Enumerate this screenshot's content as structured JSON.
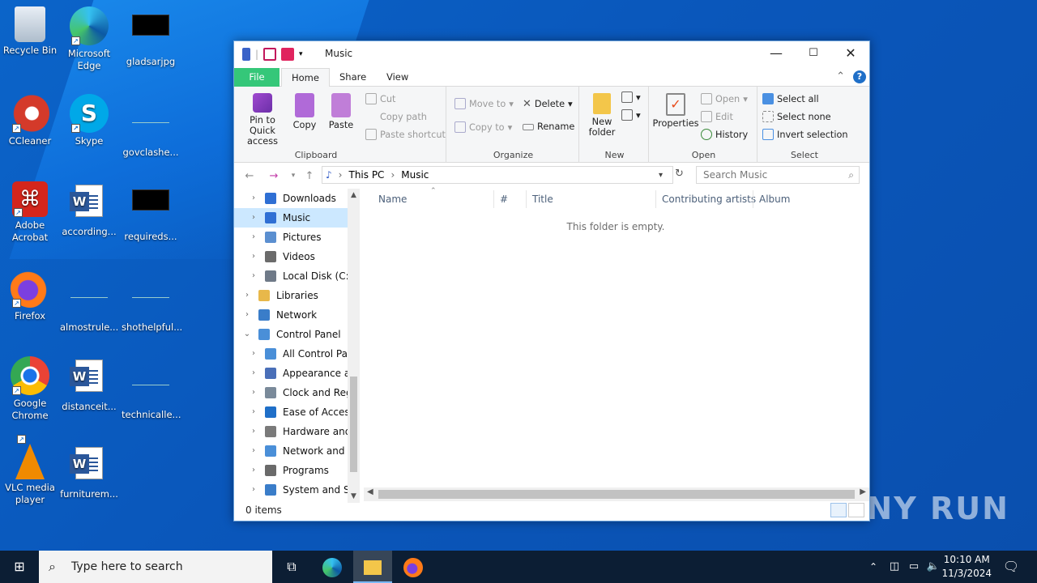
{
  "desktop": {
    "icons": [
      {
        "label": "Recycle Bin"
      },
      {
        "label": "Microsoft Edge"
      },
      {
        "label": "gladsarjpg"
      },
      {
        "label": "CCleaner"
      },
      {
        "label": "Skype"
      },
      {
        "label": "govclashe..."
      },
      {
        "label": "Adobe Acrobat"
      },
      {
        "label": "according..."
      },
      {
        "label": "requireds..."
      },
      {
        "label": "Firefox"
      },
      {
        "label": "almostrule..."
      },
      {
        "label": "shothelpful..."
      },
      {
        "label": "Google Chrome"
      },
      {
        "label": "distanceit..."
      },
      {
        "label": "technicalle..."
      },
      {
        "label": "VLC media player"
      },
      {
        "label": "furniturem..."
      }
    ]
  },
  "window": {
    "title": "Music",
    "controls": {
      "minimize": "—",
      "maximize": "☐",
      "close": "✕"
    },
    "tabs": [
      "File",
      "Home",
      "Share",
      "View"
    ],
    "ribbon": {
      "clipboard": {
        "label": "Clipboard",
        "pin": "Pin to Quick access",
        "copy": "Copy",
        "paste": "Paste",
        "cut": "Cut",
        "copy_path": "Copy path",
        "paste_shortcut": "Paste shortcut"
      },
      "organize": {
        "label": "Organize",
        "move_to": "Move to",
        "copy_to": "Copy to",
        "delete": "Delete",
        "rename": "Rename"
      },
      "new": {
        "label": "New",
        "new_folder": "New folder"
      },
      "open": {
        "label": "Open",
        "properties": "Properties",
        "open": "Open",
        "edit": "Edit",
        "history": "History"
      },
      "select": {
        "label": "Select",
        "select_all": "Select all",
        "select_none": "Select none",
        "invert": "Invert selection"
      }
    },
    "address": {
      "path": [
        "This PC",
        "Music"
      ],
      "search_placeholder": "Search Music"
    },
    "tree": [
      {
        "label": "Downloads",
        "indent": 1,
        "color": "#2f6fd4",
        "chevron": ">"
      },
      {
        "label": "Music",
        "indent": 1,
        "color": "#2f6fd4",
        "chevron": ">",
        "selected": true
      },
      {
        "label": "Pictures",
        "indent": 1,
        "color": "#5b8fd0",
        "chevron": ">"
      },
      {
        "label": "Videos",
        "indent": 1,
        "color": "#6b6b6b",
        "chevron": ">"
      },
      {
        "label": "Local Disk (C:)",
        "indent": 1,
        "color": "#6f7a88",
        "chevron": ">"
      },
      {
        "label": "Libraries",
        "indent": 0,
        "color": "#e8b84a",
        "chevron": ">"
      },
      {
        "label": "Network",
        "indent": 0,
        "color": "#3a7dc9",
        "chevron": ">"
      },
      {
        "label": "Control Panel",
        "indent": 0,
        "color": "#4a8fd8",
        "chevron": "v"
      },
      {
        "label": "All Control Par",
        "indent": 1,
        "color": "#4a8fd8",
        "chevron": ">"
      },
      {
        "label": "Appearance an",
        "indent": 1,
        "color": "#4a6fb8",
        "chevron": ">"
      },
      {
        "label": "Clock and Regi",
        "indent": 1,
        "color": "#7a8a9a",
        "chevron": ">"
      },
      {
        "label": "Ease of Access",
        "indent": 1,
        "color": "#1f6fc8",
        "chevron": ">"
      },
      {
        "label": "Hardware and",
        "indent": 1,
        "color": "#7a7a7a",
        "chevron": ">"
      },
      {
        "label": "Network and Ir",
        "indent": 1,
        "color": "#4a8fd8",
        "chevron": ">"
      },
      {
        "label": "Programs",
        "indent": 1,
        "color": "#6a6a6a",
        "chevron": ">"
      },
      {
        "label": "System and Se",
        "indent": 1,
        "color": "#3a7dc9",
        "chevron": ">"
      }
    ],
    "columns": [
      "Name",
      "#",
      "Title",
      "Contributing artists",
      "Album"
    ],
    "empty_message": "This folder is empty.",
    "status": "0 items"
  },
  "taskbar": {
    "search_placeholder": "Type here to search",
    "time": "10:10 AM",
    "date": "11/3/2024"
  },
  "watermark": "ANY RUN"
}
